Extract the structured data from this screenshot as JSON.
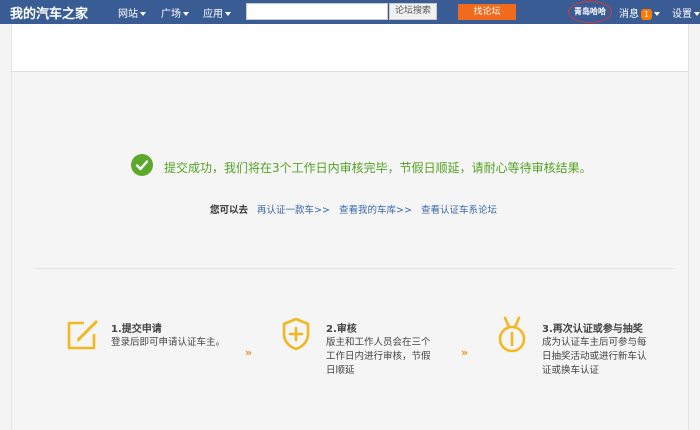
{
  "header": {
    "logo": "我的汽车之家",
    "nav": [
      {
        "label": "网站"
      },
      {
        "label": "广场"
      },
      {
        "label": "应用"
      }
    ],
    "search": {
      "value": "",
      "placeholder": "",
      "button_label": "论坛搜索"
    },
    "find_forum_label": "找论坛",
    "username": "青岛哈哈",
    "messages_label": "消息",
    "messages_count": "1",
    "settings_label": "设置"
  },
  "success": {
    "message": "提交成功，我们将在3个工作日内审核完毕，节假日顺延，请耐心等待审核结果。",
    "links_prefix": "您可以去",
    "links": [
      {
        "label": "再认证一款车>>"
      },
      {
        "label": "查看我的车库>>"
      },
      {
        "label": "查看认证车系论坛"
      }
    ]
  },
  "steps": [
    {
      "icon": "edit-icon",
      "title": "1.提交申请",
      "desc": "登录后即可申请认证车主。"
    },
    {
      "icon": "shield-plus-icon",
      "title": "2.审核",
      "desc": "版主和工作人员会在三个工作日内进行审核，节假日顺延"
    },
    {
      "icon": "medal-icon",
      "title": "3.再次认证或参与抽奖",
      "desc": "成为认证车主后可参与每日抽奖活动或进行新车认证或换车认证"
    }
  ],
  "step_arrow": "»",
  "colors": {
    "topbar": "#3a5c94",
    "accent_orange": "#f26a1b",
    "success_green": "#5ba92c",
    "link_blue": "#3a68a8",
    "icon_yellow": "#f2b822"
  }
}
